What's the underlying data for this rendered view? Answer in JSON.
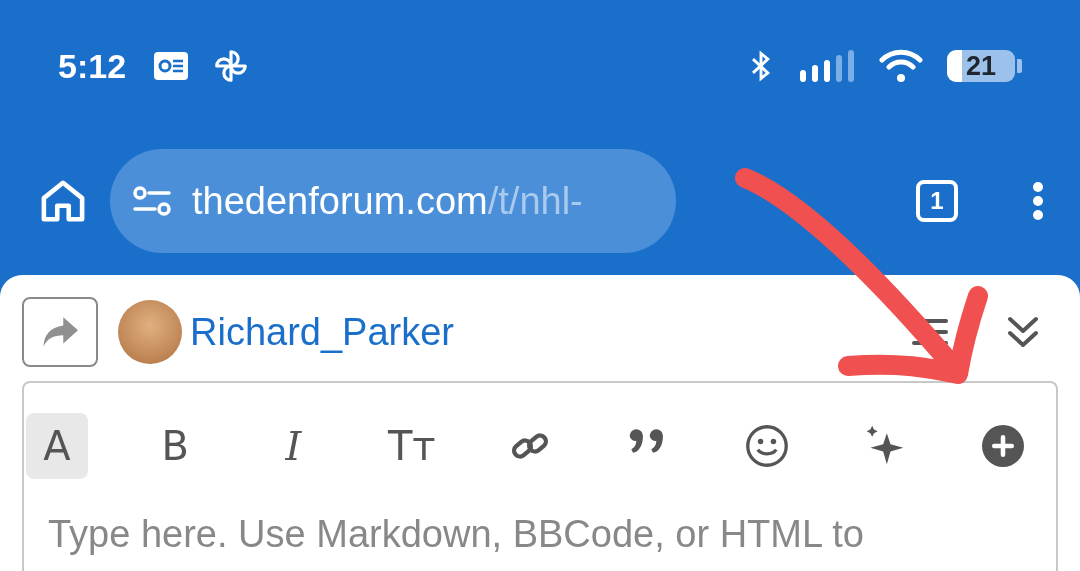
{
  "status_bar": {
    "time": "5:12",
    "battery": "21"
  },
  "browser": {
    "url_host": "thedenforum.com",
    "url_path": "/t/nhl-",
    "tab_count": "1"
  },
  "composer": {
    "username": "Richard_Parker",
    "toolbar": [
      {
        "kind": "glyph",
        "glyph": "A",
        "selected": true
      },
      {
        "kind": "glyph",
        "glyph": "B",
        "selected": false
      },
      {
        "kind": "italic",
        "glyph": "I",
        "selected": false
      },
      {
        "kind": "glyph",
        "glyph": "Tт",
        "selected": false
      },
      {
        "kind": "link",
        "selected": false
      },
      {
        "kind": "quote",
        "selected": false
      },
      {
        "kind": "emoji",
        "selected": false
      },
      {
        "kind": "sparkle",
        "selected": false
      },
      {
        "kind": "plus",
        "selected": false
      }
    ],
    "placeholder": "Type here. Use Markdown, BBCode, or HTML to"
  }
}
